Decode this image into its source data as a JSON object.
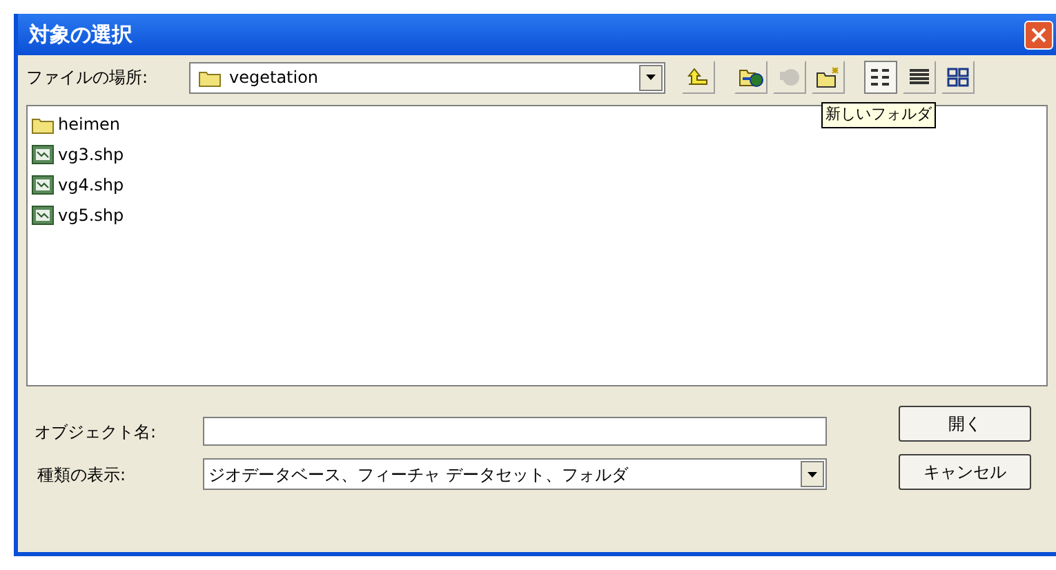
{
  "window": {
    "title": "対象の選択"
  },
  "location": {
    "label": "ファイルの場所:",
    "value": "vegetation"
  },
  "toolbar": {
    "views": [
      {
        "kind": "list",
        "selected": true
      },
      {
        "kind": "details",
        "selected": false
      },
      {
        "kind": "thumbnails",
        "selected": false
      }
    ],
    "tooltip": "新しいフォルダ"
  },
  "files": [
    {
      "kind": "folder",
      "name": "heimen"
    },
    {
      "kind": "shapefile",
      "name": "vg3.shp"
    },
    {
      "kind": "shapefile",
      "name": "vg4.shp"
    },
    {
      "kind": "shapefile",
      "name": "vg5.shp"
    }
  ],
  "object_name": {
    "label": "オブジェクト名:"
  },
  "file_type": {
    "label": "種類の表示:",
    "value": "ジオデータベース、フィーチャ データセット、フォルダ"
  },
  "buttons": [
    "開く",
    "キャンセル"
  ]
}
